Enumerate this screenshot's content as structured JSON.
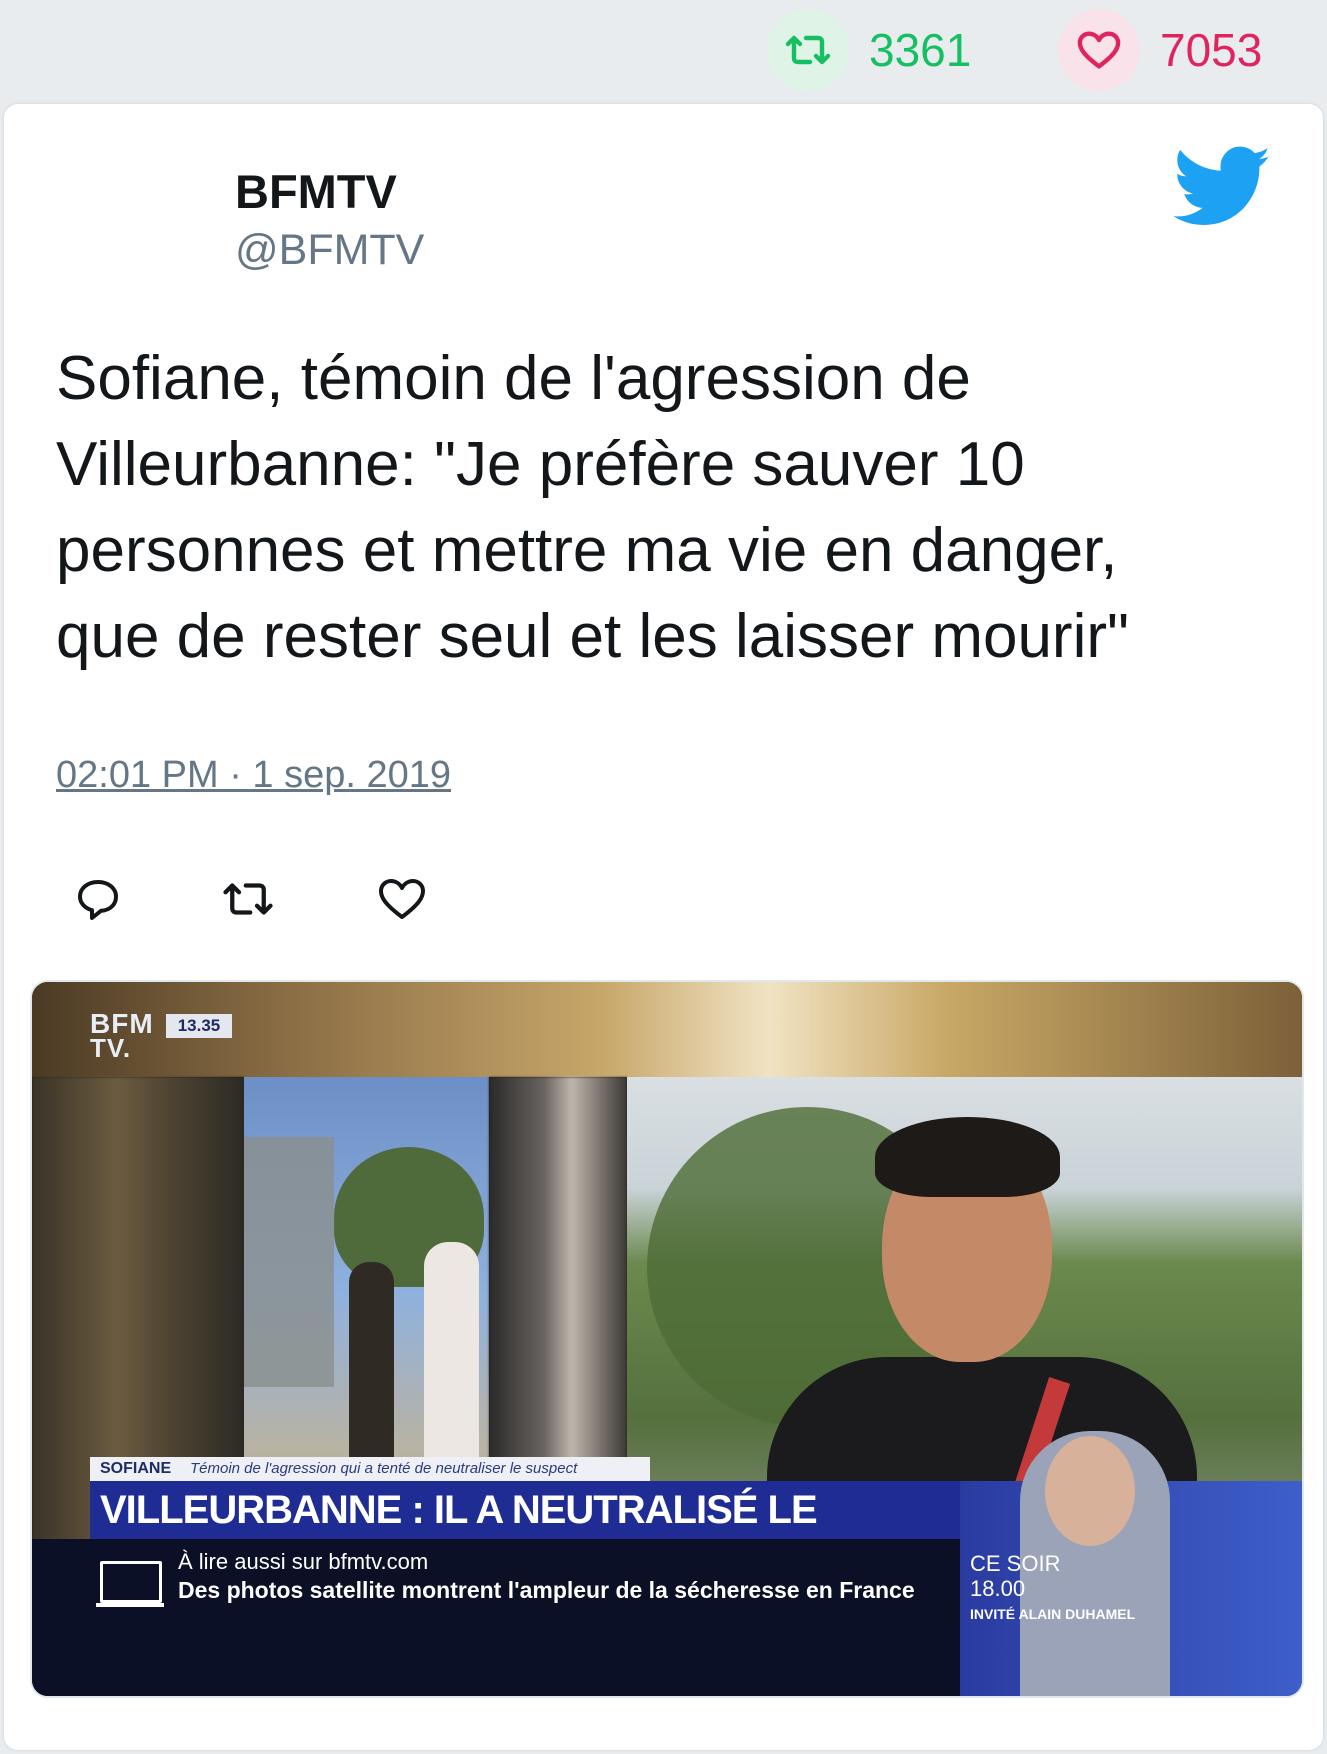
{
  "stats": {
    "retweets": "3361",
    "likes": "7053",
    "retweet_color": "#17bf63",
    "like_color": "#e0245e",
    "retweet_icon": "retweet-icon",
    "like_icon": "heart-icon"
  },
  "tweet": {
    "name": "BFMTV",
    "handle": "@BFMTV",
    "text": "Sofiane, témoin de l'agression de\nVilleurbanne: \"Je préfère sauver 10\npersonnes et mettre ma vie en danger,\nque de rester seul et les laisser mourir\"",
    "timestamp": "02:01 PM · 1 sep. 2019",
    "brand_icon": "twitter-bird-icon",
    "actions": [
      "reply-icon",
      "retweet-icon",
      "heart-icon"
    ]
  },
  "media": {
    "channel_logo_line1": "BFM",
    "channel_logo_line2": "TV.",
    "clock": "13.35",
    "lower_third_name": "SOFIANE",
    "lower_third_role": "Témoin de l'agression qui a tenté de neutraliser le suspect",
    "headline": "VILLEURBANNE : IL A NEUTRALISÉ LE SUSPECT",
    "ticker_line1": "À lire aussi sur bfmtv.com",
    "ticker_line2": "Des photos satellite montrent l'ampleur de la sécheresse en France",
    "promo_line1": "CE SOIR",
    "promo_line2": "18.00",
    "promo_line3": "INVITÉ ALAIN DUHAMEL"
  }
}
